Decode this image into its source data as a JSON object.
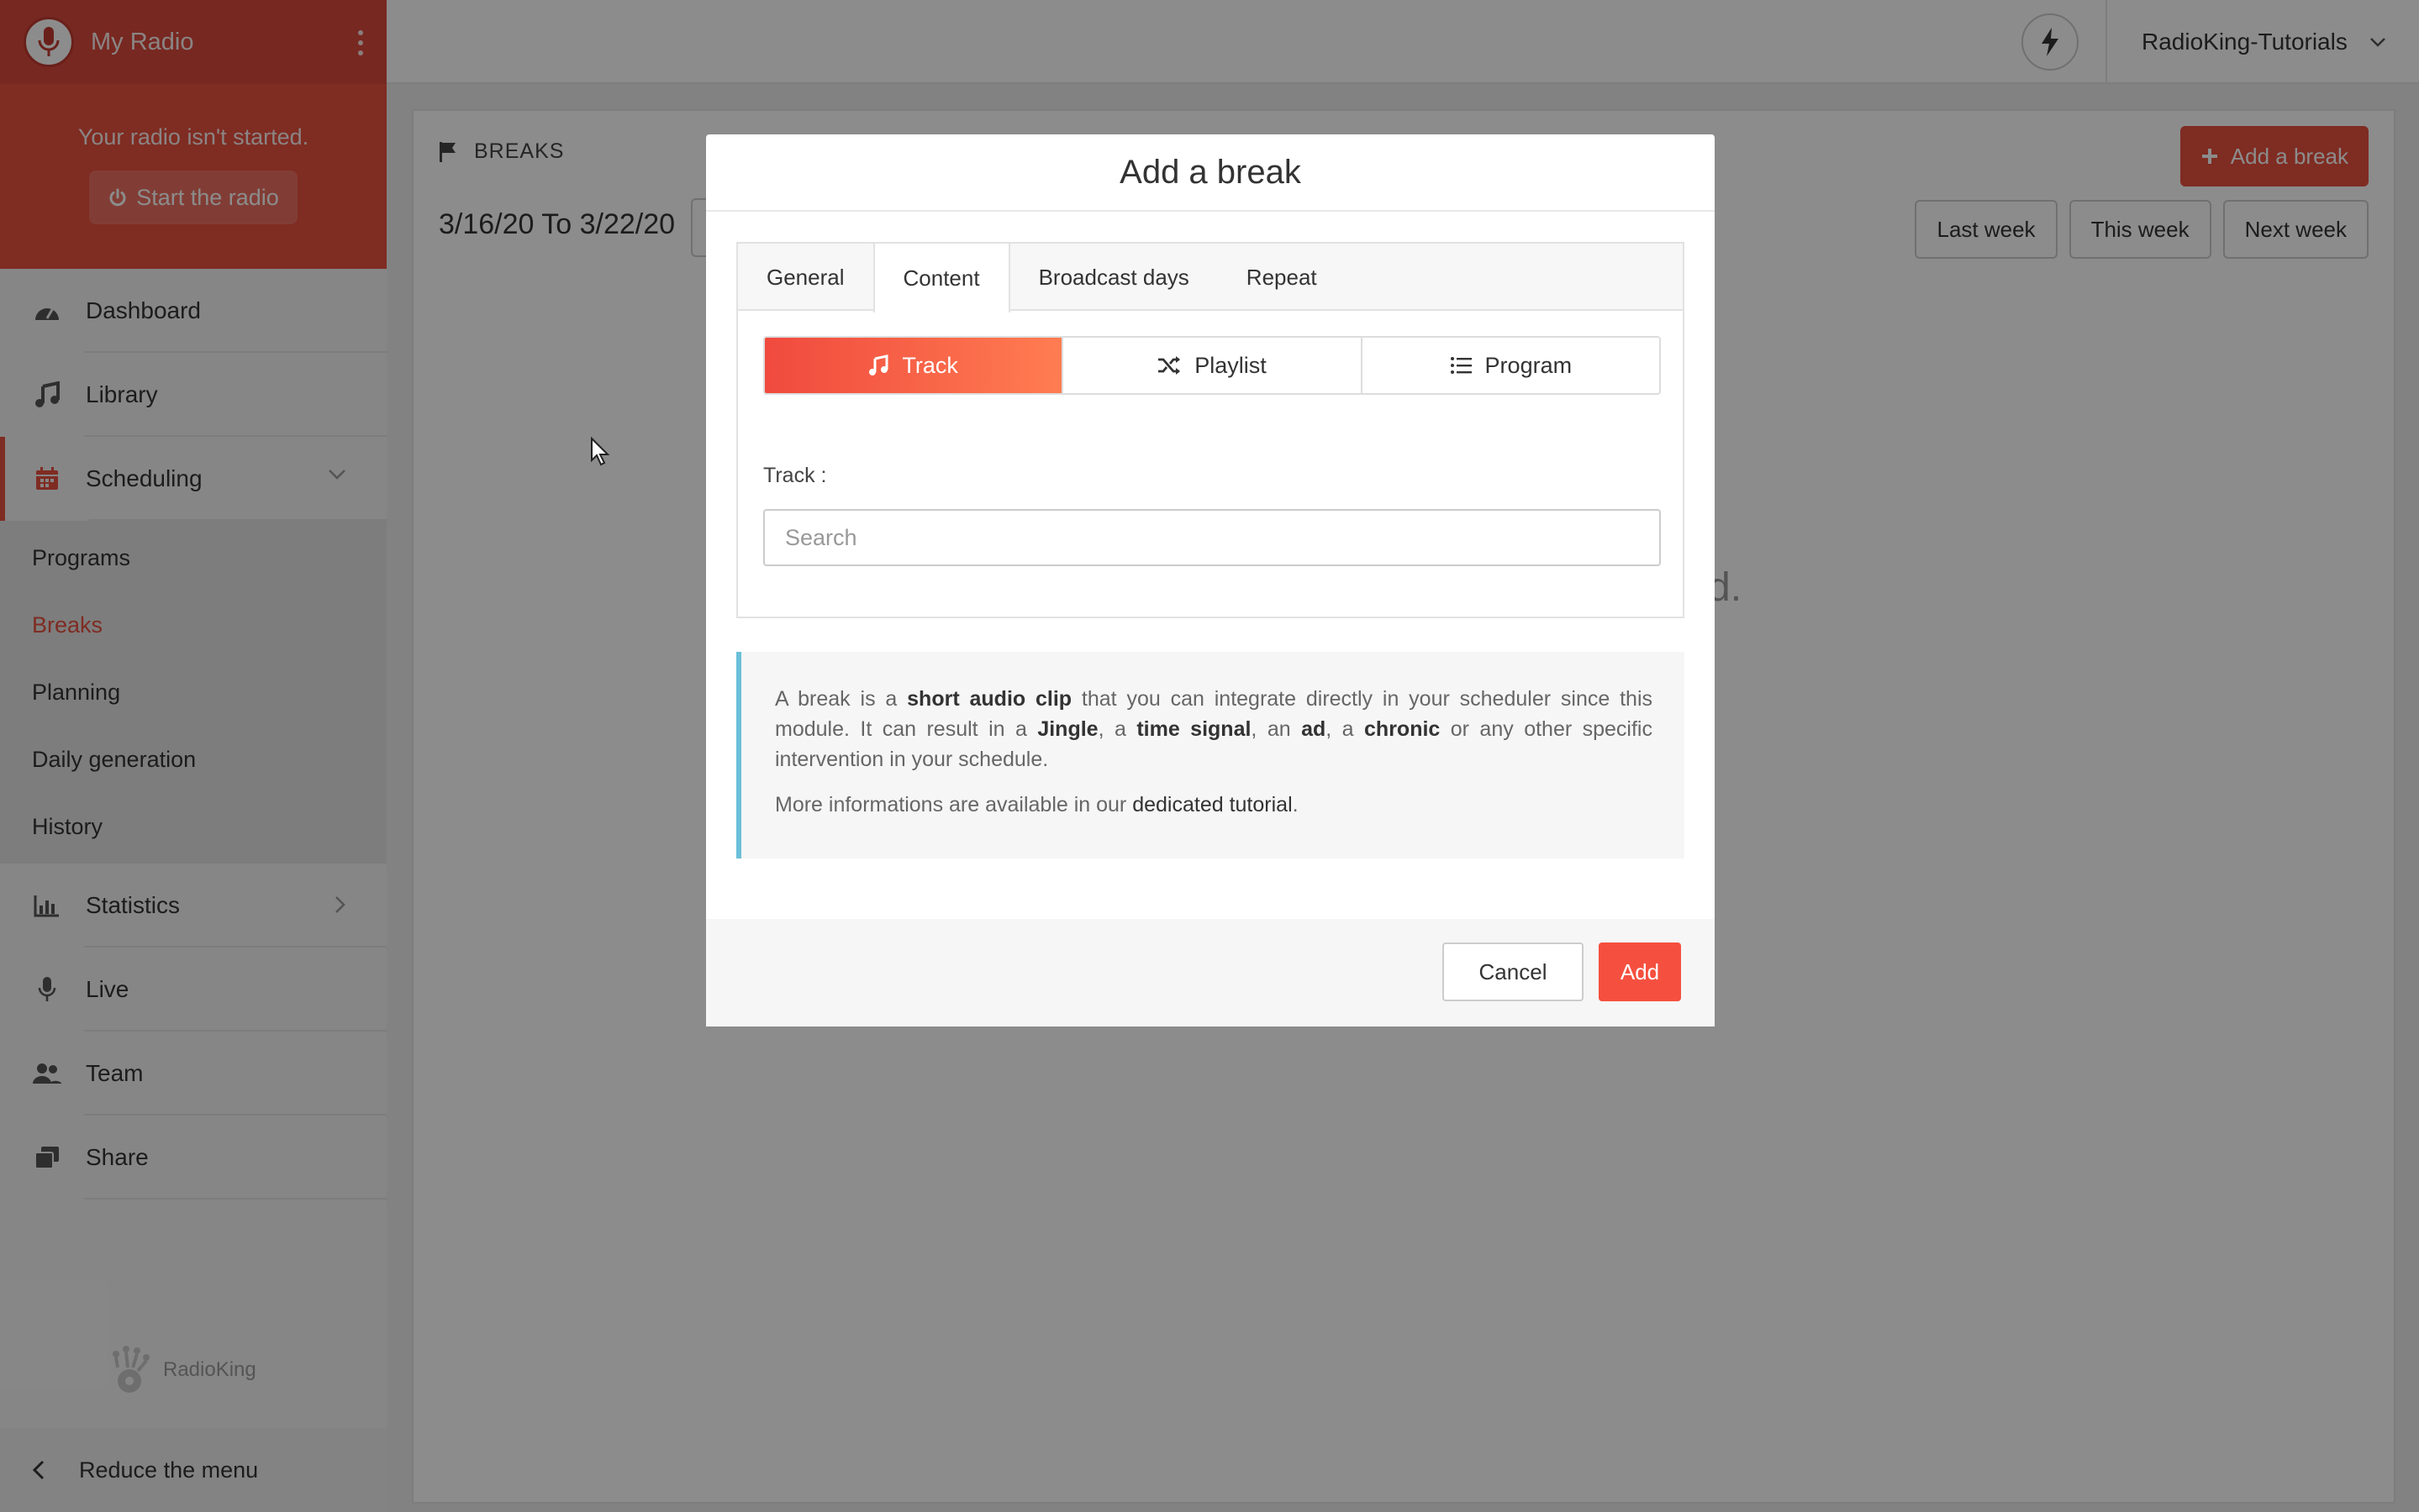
{
  "sidebar": {
    "radio_name": "My Radio",
    "status_text": "Your radio isn't started.",
    "start_button": "Start the radio",
    "nav": {
      "dashboard": "Dashboard",
      "library": "Library",
      "scheduling": "Scheduling",
      "statistics": "Statistics",
      "live": "Live",
      "team": "Team",
      "share": "Share"
    },
    "subnav": {
      "programs": "Programs",
      "breaks": "Breaks",
      "planning": "Planning",
      "daily_generation": "Daily generation",
      "history": "History"
    },
    "brand": "RadioKing",
    "reduce_menu": "Reduce the menu",
    "accent_color": "#e8503f"
  },
  "header": {
    "account_name": "RadioKing-Tutorials"
  },
  "page": {
    "breadcrumb": "BREAKS",
    "date_range": "3/16/20 To 3/22/20",
    "add_break_button": "Add a break",
    "last_week": "Last week",
    "this_week": "This week",
    "next_week": "Next week",
    "empty_text_tail": "d."
  },
  "modal": {
    "title": "Add a break",
    "tabs": {
      "general": "General",
      "content": "Content",
      "broadcast_days": "Broadcast days",
      "repeat": "Repeat"
    },
    "content_types": {
      "track": "Track",
      "playlist": "Playlist",
      "program": "Program"
    },
    "track_label": "Track :",
    "search_placeholder": "Search",
    "info": {
      "p1_a": "A break is a ",
      "p1_b": "short audio clip",
      "p1_c": " that you can integrate directly in your scheduler since this module. It can result in a ",
      "p1_d": "Jingle",
      "p1_e": ", a ",
      "p1_f": "time signal",
      "p1_g": ", an ",
      "p1_h": "ad",
      "p1_i": ", a ",
      "p1_j": "chronic",
      "p1_k": " or any other specific intervention in your schedule.",
      "p2_a": "More informations are available in our ",
      "p2_link": "dedicated tutorial",
      "p2_b": "."
    },
    "cancel": "Cancel",
    "add": "Add"
  }
}
